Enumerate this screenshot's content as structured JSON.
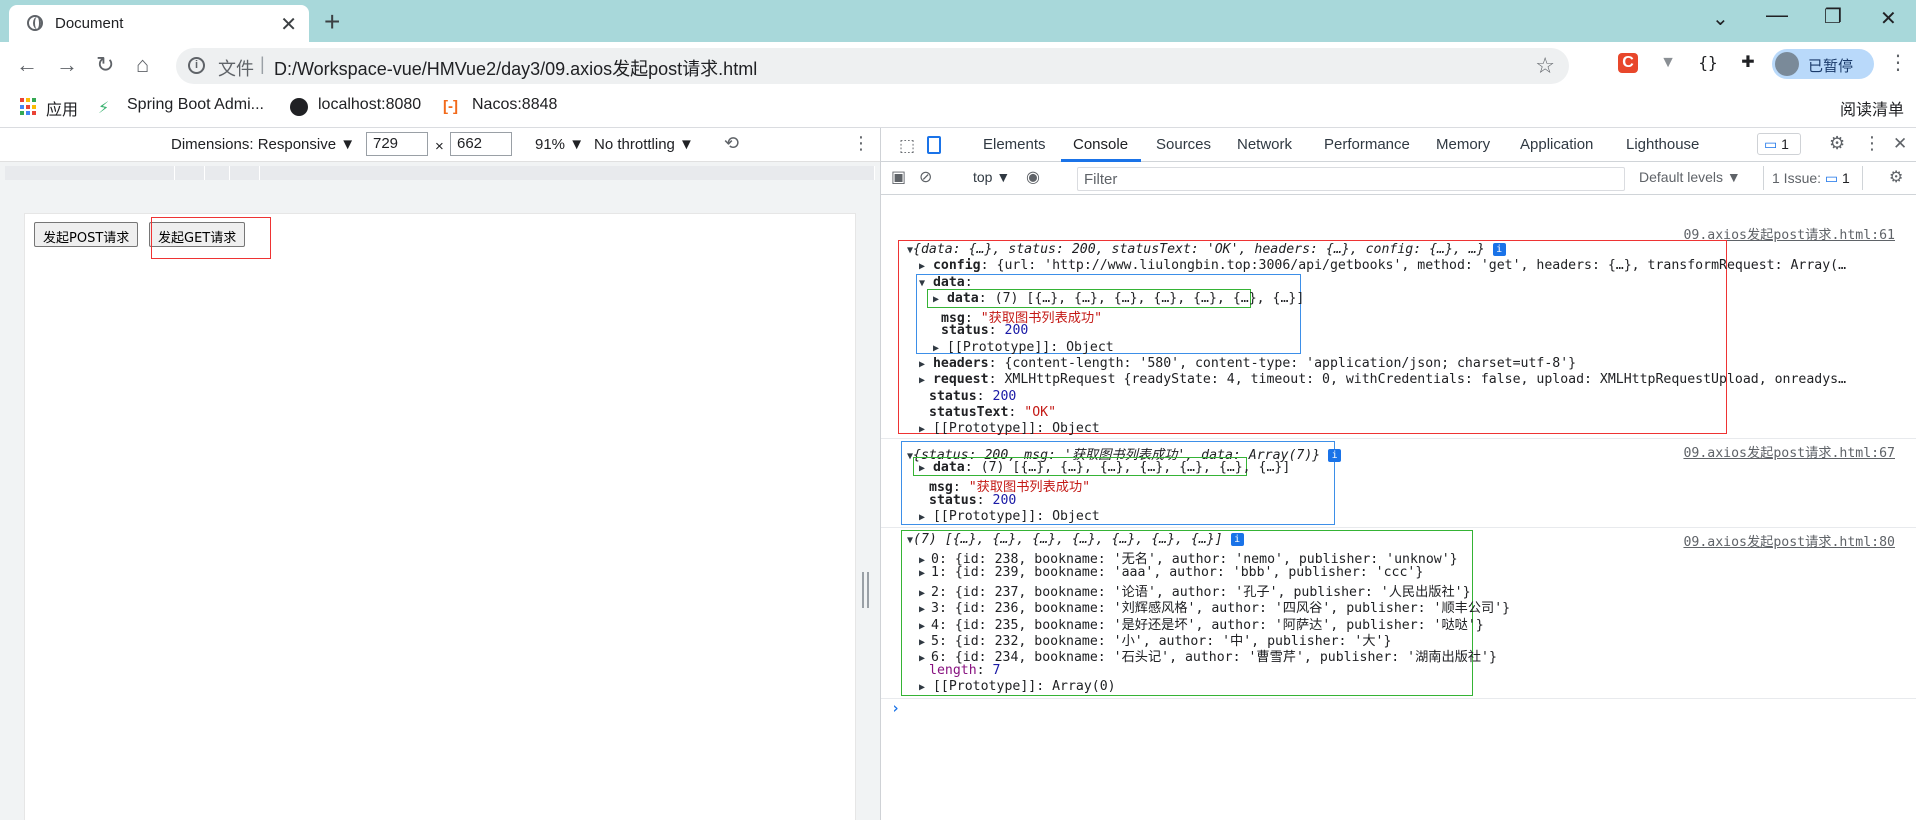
{
  "browser": {
    "tab_title": "Document",
    "new_tab": "+",
    "url_scheme": "文件",
    "url": "D:/Workspace-vue/HMVue2/day3/09.axios发起post请求.html",
    "profile_label": "已暂停",
    "reading_list": "阅读清单"
  },
  "bookmarks": [
    {
      "label": "应用"
    },
    {
      "label": "Spring Boot Admi..."
    },
    {
      "label": "localhost:8080"
    },
    {
      "label": "Nacos:8848"
    }
  ],
  "device_toolbar": {
    "dimensions_label": "Dimensions: Responsive ▼",
    "width": "729",
    "times": "×",
    "height": "662",
    "zoom": "91% ▼",
    "throttling": "No throttling ▼"
  },
  "page": {
    "post_button": "发起POST请求",
    "get_button": "发起GET请求"
  },
  "devtools": {
    "tabs": [
      "Elements",
      "Console",
      "Sources",
      "Network",
      "Performance",
      "Memory",
      "Application",
      "Lighthouse"
    ],
    "active_tab": "Console",
    "issues_badge": "1",
    "context": "top ▼",
    "filter_placeholder": "Filter",
    "levels": "Default levels ▼",
    "issue_count": "1 Issue:",
    "issue_badge_num": "1"
  },
  "console": {
    "src1": "09.axios发起post请求.html:61",
    "src2": "09.axios发起post请求.html:67",
    "src3": "09.axios发起post请求.html:80",
    "l1": "{data: {…}, status: 200, statusText: 'OK', headers: {…}, config: {…}, …}",
    "l2_key": "config",
    "l2_val": ": {url: 'http://www.liulongbin.top:3006/api/getbooks', method: 'get', headers: {…}, transformRequest: Array(…",
    "l3_key": "data",
    "l4_key": "data",
    "l4_val": ": (7) [{…}, {…}, {…}, {…}, {…}, {…}, {…}]",
    "l5_key": "msg",
    "l5_val": "\"获取图书列表成功\"",
    "l6_key": "status",
    "l6_val": "200",
    "l7": "[[Prototype]]: Object",
    "l8_key": "headers",
    "l8_val": ": {content-length: '580', content-type: 'application/json; charset=utf-8'}",
    "l9_key": "request",
    "l9_val": ": XMLHttpRequest {readyState: 4, timeout: 0, withCredentials: false, upload: XMLHttpRequestUpload, onreadys…",
    "l10_key": "status",
    "l10_val": "200",
    "l11_key": "statusText",
    "l11_val": "\"OK\"",
    "l12": "[[Prototype]]: Object",
    "m1": "{status: 200, msg: '获取图书列表成功', data: Array(7)}",
    "m2_key": "data",
    "m2_val": ": (7) [{…}, {…}, {…}, {…}, {…}, {…}, {…}]",
    "m3_key": "msg",
    "m3_val": "\"获取图书列表成功\"",
    "m4_key": "status",
    "m4_val": "200",
    "m5": "[[Prototype]]: Object",
    "a1": "(7) [{…}, {…}, {…}, {…}, {…}, {…}, {…}]",
    "rows": [
      "0: {id: 238, bookname: '无名', author: 'nemo', publisher: 'unknow'}",
      "1: {id: 239, bookname: 'aaa', author: 'bbb', publisher: 'ccc'}",
      "2: {id: 237, bookname: '论语', author: '孔子', publisher: '人民出版社'}",
      "3: {id: 236, bookname: '刘辉感风格', author: '四风谷', publisher: '顺丰公司'}",
      "4: {id: 235, bookname: '是好还是坏', author: '阿萨达', publisher: '哒哒'}",
      "5: {id: 232, bookname: '小', author: '中', publisher: '大'}",
      "6: {id: 234, bookname: '石头记', author: '曹雪芹', publisher: '湖南出版社'}"
    ],
    "length_key": "length",
    "length_val": "7",
    "a_proto": "[[Prototype]]: Array(0)",
    "prompt": "›"
  }
}
